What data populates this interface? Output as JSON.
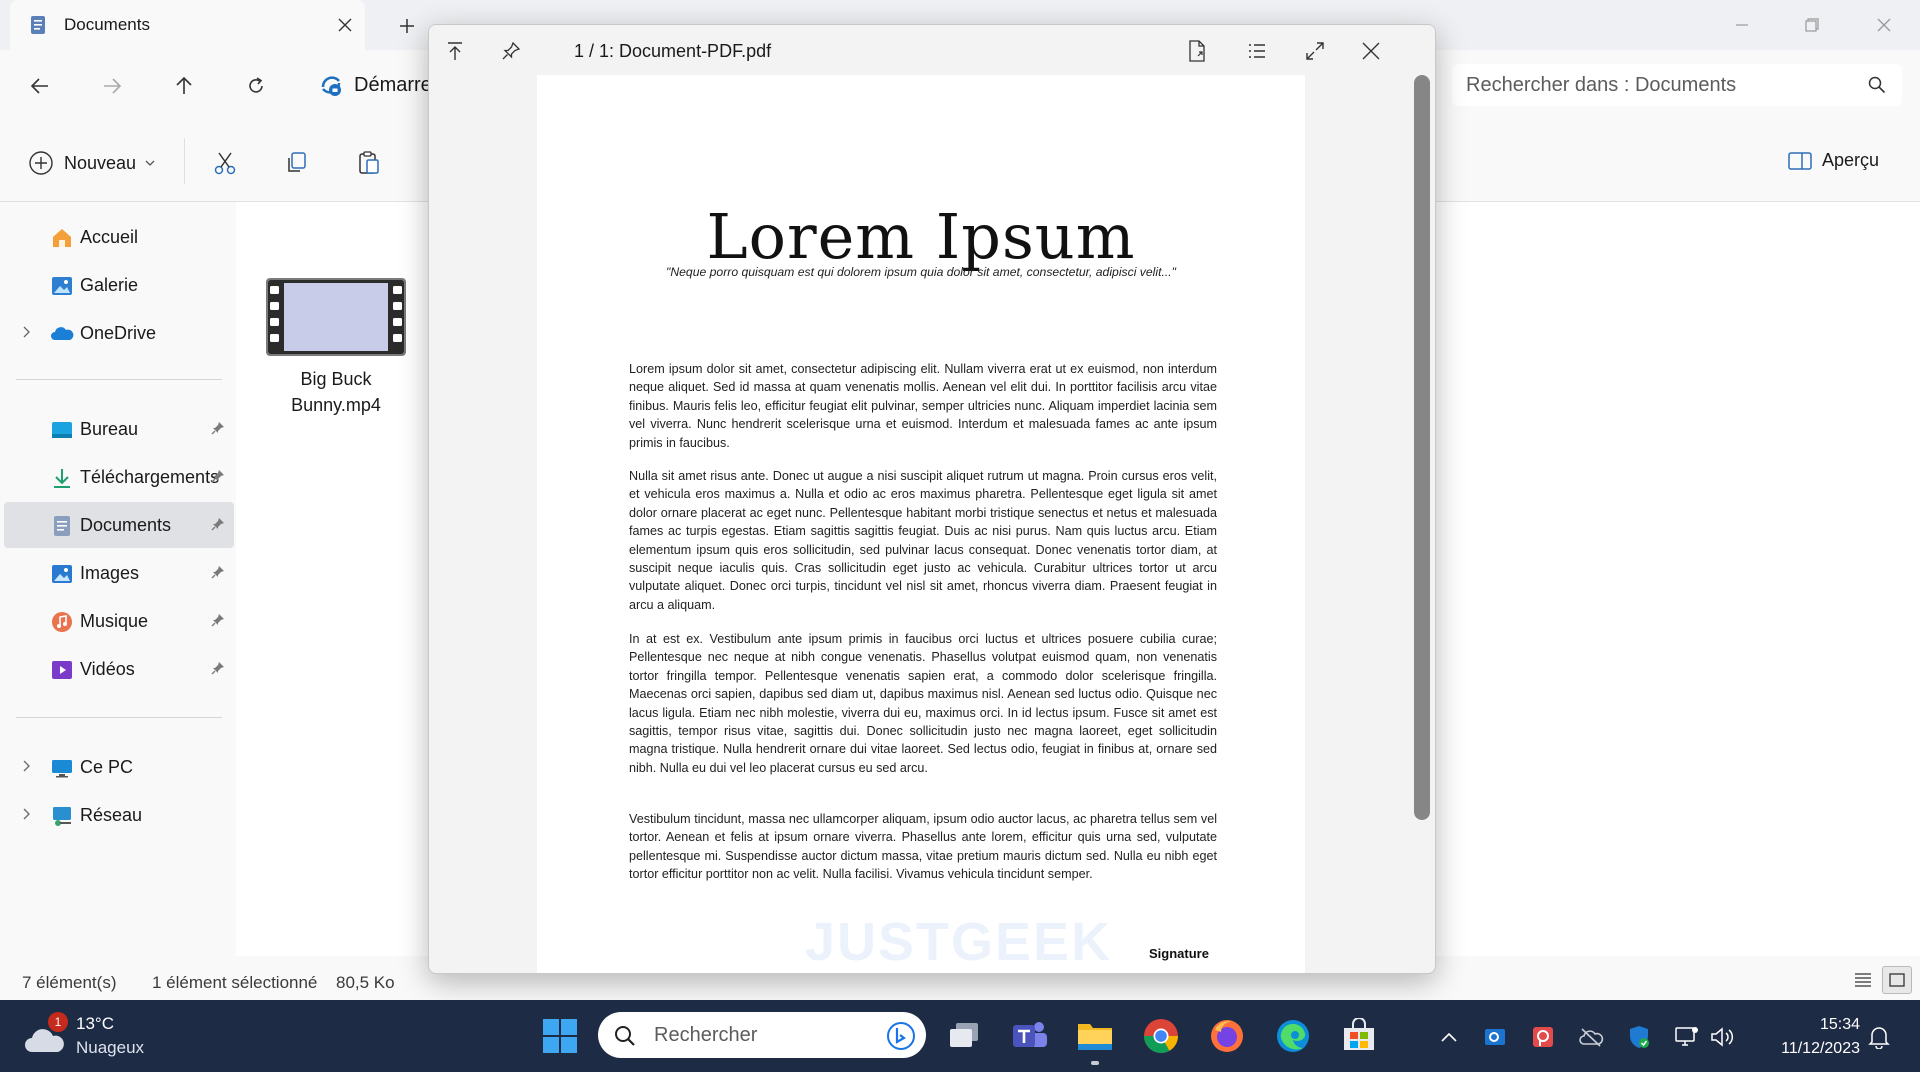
{
  "window": {
    "tab_title": "Documents",
    "address_text": "Démarrer",
    "search_placeholder": "Rechercher dans : Documents"
  },
  "command_bar": {
    "new_label": "Nouveau",
    "preview_label": "Aperçu"
  },
  "sidebar": {
    "items": [
      {
        "label": "Accueil",
        "icon": "home-icon"
      },
      {
        "label": "Galerie",
        "icon": "gallery-icon"
      },
      {
        "label": "OneDrive",
        "icon": "onedrive-icon"
      },
      {
        "label": "Bureau",
        "icon": "desktop-folder-icon",
        "pinned": true
      },
      {
        "label": "Téléchargements",
        "icon": "download-icon",
        "pinned": true
      },
      {
        "label": "Documents",
        "icon": "documents-icon",
        "pinned": true,
        "selected": true
      },
      {
        "label": "Images",
        "icon": "images-icon",
        "pinned": true
      },
      {
        "label": "Musique",
        "icon": "music-icon",
        "pinned": true
      },
      {
        "label": "Vidéos",
        "icon": "videos-icon",
        "pinned": true
      },
      {
        "label": "Ce PC",
        "icon": "pc-icon"
      },
      {
        "label": "Réseau",
        "icon": "network-icon"
      }
    ]
  },
  "files": [
    {
      "name_line1": "Big Buck",
      "name_line2": "Bunny.mp4",
      "icon": "video-file-icon"
    }
  ],
  "status": {
    "count": "7 élément(s)",
    "selection": "1 élément sélectionné",
    "size": "80,5 Ko"
  },
  "preview": {
    "title": "1 / 1: Document-PDF.pdf",
    "doc_title": "Lorem Ipsum",
    "quote": "\"Neque porro quisquam est qui dolorem ipsum quia dolor sit amet, consectetur, adipisci velit...\"",
    "paragraphs": [
      "Lorem ipsum dolor sit amet, consectetur adipiscing elit. Nullam viverra erat ut ex euismod, non interdum neque aliquet. Sed id massa at quam venenatis mollis. Aenean vel elit dui. In porttitor facilisis arcu vitae finibus. Mauris felis leo, efficitur feugiat elit pulvinar, semper ultricies nunc. Aliquam imperdiet lacinia sem vel viverra. Nunc hendrerit scelerisque urna et euismod. Interdum et malesuada fames ac ante ipsum primis in faucibus.",
      "Nulla sit amet risus ante. Donec ut augue a nisi suscipit aliquet rutrum ut magna. Proin cursus eros velit, et vehicula eros maximus a. Nulla et odio ac eros maximus pharetra. Pellentesque eget ligula sit amet dolor ornare placerat ac eget nunc. Pellentesque habitant morbi tristique senectus et netus et malesuada fames ac turpis egestas. Etiam sagittis sagittis feugiat. Duis ac nisi purus. Nam quis luctus arcu. Etiam elementum ipsum quis eros sollicitudin, sed pulvinar lacus consequat. Donec venenatis tortor diam, at suscipit neque iaculis quis. Cras sollicitudin eget justo ac vehicula. Curabitur ultrices tortor ut arcu vulputate aliquet. Donec orci turpis, tincidunt vel nisl sit amet, rhoncus viverra diam. Praesent feugiat in arcu a aliquam.",
      "In at est ex. Vestibulum ante ipsum primis in faucibus orci luctus et ultrices posuere cubilia curae; Pellentesque nec neque at nibh congue venenatis. Phasellus volutpat euismod quam, non venenatis tortor fringilla tempor. Pellentesque venenatis sapien erat, a commodo dolor scelerisque fringilla. Maecenas orci sapien, dapibus sed diam ut, dapibus maximus nisl. Aenean sed luctus odio. Quisque nec lacus ligula. Etiam nec nibh molestie, viverra dui eu, maximus orci. In id lectus ipsum. Fusce sit amet est sagittis, tempor risus vitae, sagittis dui. Donec sollicitudin justo nec magna laoreet, eget sollicitudin magna tristique. Nulla hendrerit ornare dui vitae laoreet. Sed lectus odio, feugiat in finibus at, ornare sed nibh. Nulla eu dui vel leo placerat cursus eu sed arcu.",
      "Vestibulum tincidunt, massa nec ullamcorper aliquam, ipsum odio auctor lacus, ac pharetra tellus sem vel tortor. Aenean et felis at ipsum ornare viverra. Phasellus ante lorem, efficitur quis urna sed, vulputate pellentesque mi. Suspendisse auctor dictum massa, vitae pretium mauris dictum sed. Nulla eu nibh eget tortor efficitur porttitor non ac velit. Nulla facilisi. Vivamus vehicula tincidunt semper."
    ],
    "signature": "Signature",
    "watermark": "JUSTGEEK"
  },
  "taskbar": {
    "weather_temp": "13°C",
    "weather_desc": "Nuageux",
    "weather_badge": "1",
    "search_placeholder": "Rechercher",
    "time": "15:34",
    "date": "11/12/2023"
  },
  "colors": {
    "accent": "#0067c0",
    "taskbar": "#1e2b45",
    "selected_sidebar": "#dfe1e5"
  }
}
